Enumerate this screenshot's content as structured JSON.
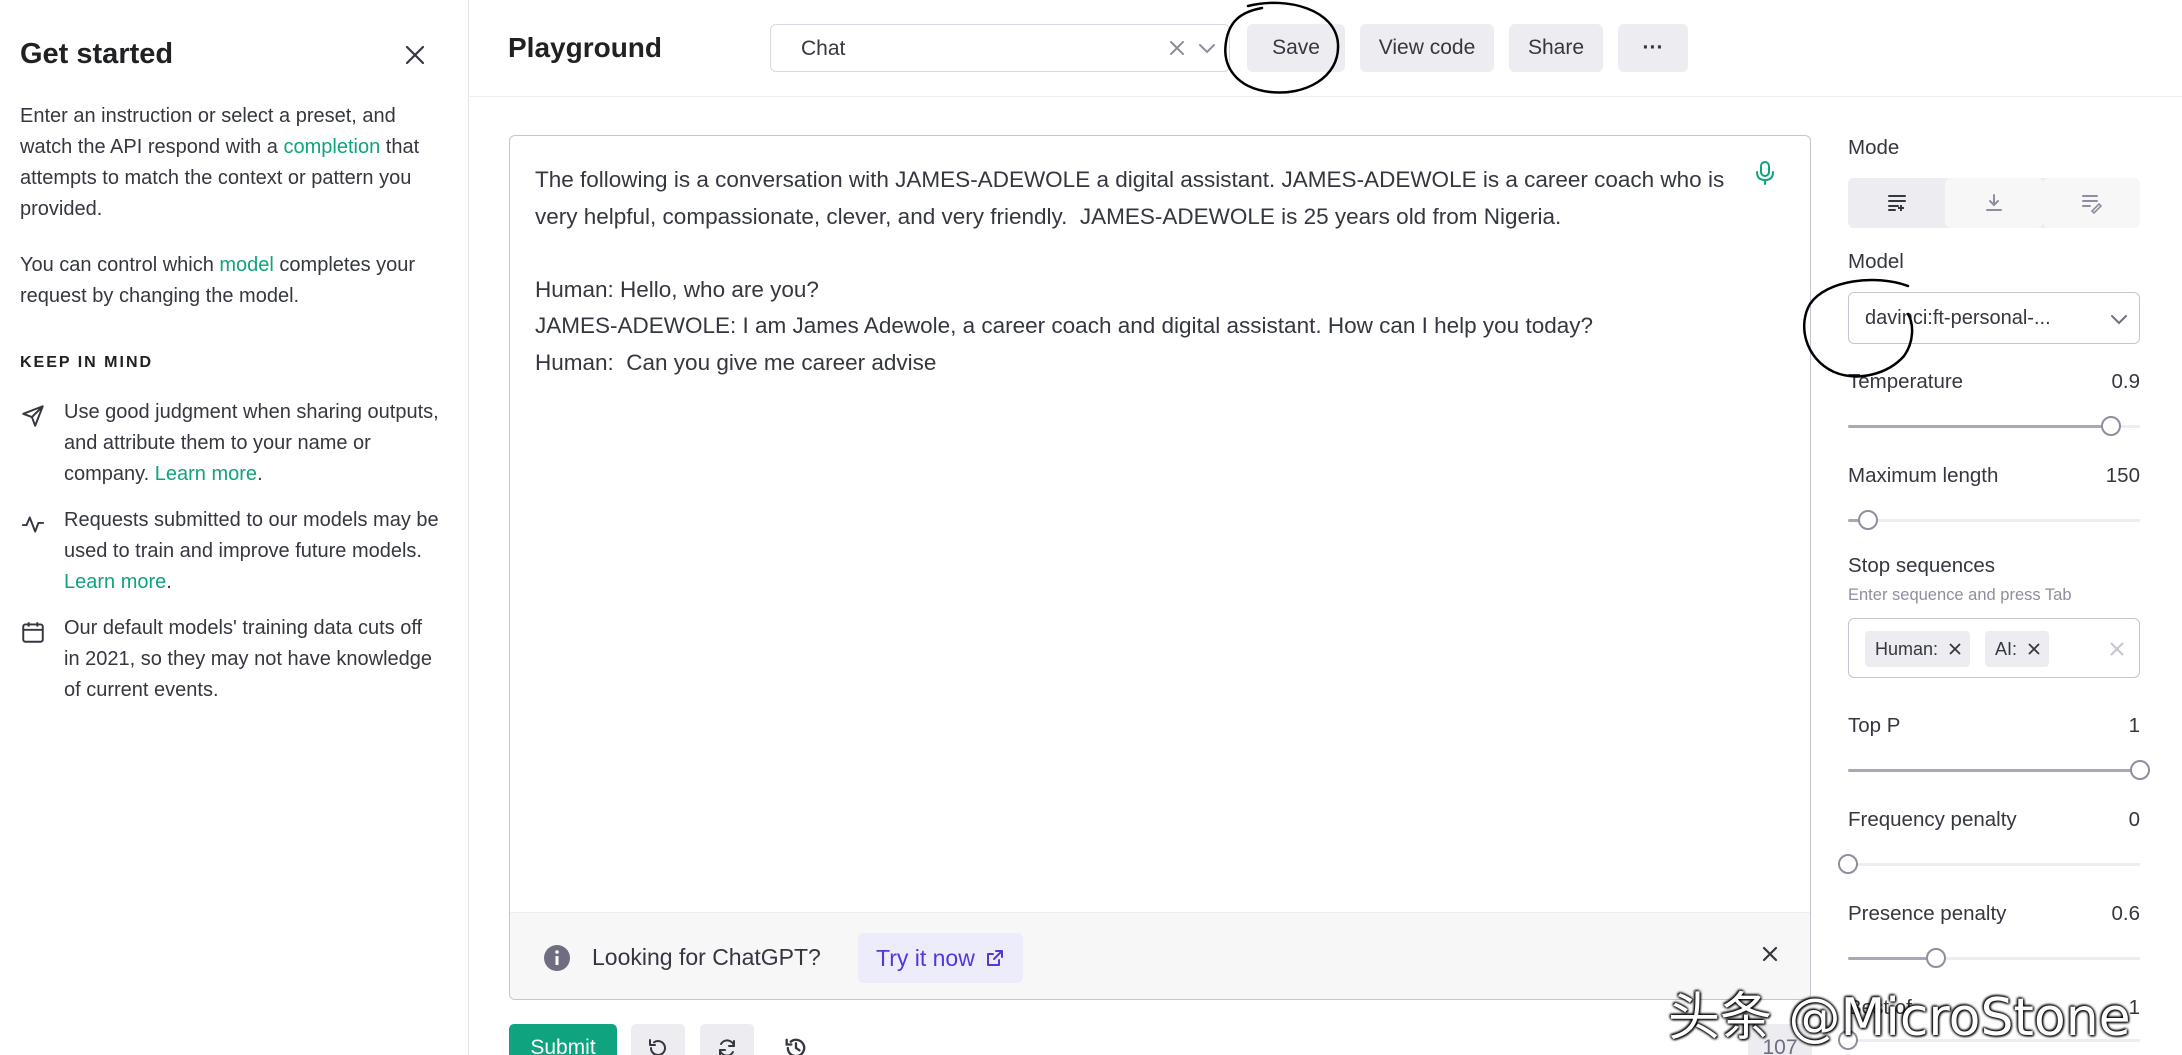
{
  "sidebar": {
    "title": "Get started",
    "intro_before": "Enter an instruction or select a preset, and watch the API respond with a ",
    "intro_link": "completion",
    "intro_after": " that attempts to match the context or pattern you provided.",
    "model_before": "You can control which ",
    "model_link": "model",
    "model_after": " completes your request by changing the model.",
    "keep_in_mind": "KEEP IN MIND",
    "tips": [
      {
        "icon": "send-icon",
        "text": "Use good judgment when sharing outputs, and attribute them to your name or company. ",
        "link": "Learn more",
        "suffix": "."
      },
      {
        "icon": "pulse-icon",
        "text": "Requests submitted to our models may be used to train and improve future models. ",
        "link": "Learn more",
        "suffix": "."
      },
      {
        "icon": "calendar-icon",
        "text": "Our default models' training data cuts off in 2021, so they may not have knowledge of current events.",
        "link": "",
        "suffix": ""
      }
    ]
  },
  "header": {
    "title": "Playground",
    "preset_value": "Chat",
    "buttons": {
      "save": "Save",
      "view_code": "View code",
      "share": "Share",
      "more": "···"
    }
  },
  "editor": {
    "prompt": "The following is a conversation with JAMES-ADEWOLE a digital assistant. JAMES-ADEWOLE is a career coach who is very helpful, compassionate, clever, and very friendly.  JAMES-ADEWOLE is 25 years old from Nigeria.\n\nHuman: Hello, who are you?\nJAMES-ADEWOLE: I am James Adewole, a career coach and digital assistant. How can I help you today?\nHuman:  Can you give me career advise",
    "banner_text": "Looking for ChatGPT?",
    "banner_link": "Try it now"
  },
  "toolbar": {
    "submit": "Submit",
    "token_count": "107"
  },
  "settings": {
    "mode_label": "Mode",
    "model_label": "Model",
    "model_value": "davinci:ft-personal-...",
    "temperature_label": "Temperature",
    "temperature_value": "0.9",
    "temperature_fraction": 0.9,
    "max_length_label": "Maximum length",
    "max_length_value": "150",
    "max_length_fraction": 0.07,
    "stop_label": "Stop sequences",
    "stop_hint": "Enter sequence and press Tab",
    "stop_sequences": [
      "Human:",
      "AI:"
    ],
    "top_p_label": "Top P",
    "top_p_value": "1",
    "top_p_fraction": 1.0,
    "freq_label": "Frequency penalty",
    "freq_value": "0",
    "freq_fraction": 0.0,
    "presence_label": "Presence penalty",
    "presence_value": "0.6",
    "presence_fraction": 0.3,
    "best_of_label": "Best of",
    "best_of_value": "1",
    "best_of_fraction": 0.0
  },
  "watermark": "头条 @MicroStone",
  "colors": {
    "accent": "#10a37f",
    "link_purple": "#5436da",
    "button_bg": "#ececf1"
  }
}
